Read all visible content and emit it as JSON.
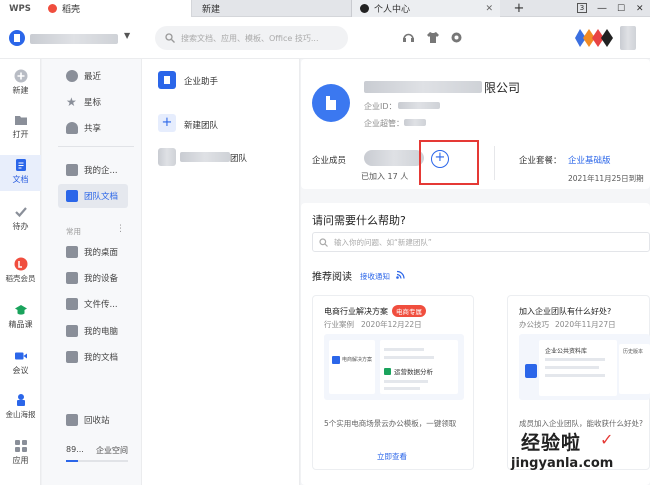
{
  "tabbar": {
    "app": "WPS",
    "tabs": [
      {
        "label": "稻壳"
      },
      {
        "label": "新建"
      },
      {
        "label": "个人中心"
      }
    ],
    "new_tab": "+",
    "win_badge": "3"
  },
  "search": {
    "placeholder": "搜索文档、应用、模板、Office 技巧..."
  },
  "sidebar": {
    "items": [
      {
        "label": "新建"
      },
      {
        "label": "打开"
      },
      {
        "label": "文档"
      },
      {
        "label": "待办"
      },
      {
        "label": "稻壳会员"
      },
      {
        "label": "精品课"
      },
      {
        "label": "会议"
      },
      {
        "label": "金山海报"
      },
      {
        "label": "应用"
      }
    ]
  },
  "nav2": {
    "recent": "最近",
    "star": "星标",
    "share": "共享",
    "my_company": "我的企...",
    "team_docs": "团队文档",
    "common": "常用",
    "desktop": "我的桌面",
    "devices": "我的设备",
    "file_transfer": "文件传...",
    "my_pc": "我的电脑",
    "my_docs": "我的文档",
    "recycle": "回收站",
    "space_num": "89...",
    "space": "企业空间"
  },
  "col3": {
    "assistant": "企业助手",
    "new_team": "新建团队",
    "team_suffix": "团队"
  },
  "company": {
    "name_suffix": "限公司",
    "id_label": "企业ID：",
    "admin_label": "企业超管：",
    "members_label": "企业成员",
    "joined": "已加入 17 人",
    "plan_label": "企业套餐：",
    "plan_value": "企业基础版",
    "expiry": "2021年11月25日到期"
  },
  "help": {
    "title": "请问需要什么帮助?",
    "placeholder": "输入你的问题、如“新建团队”"
  },
  "reading": {
    "title": "推荐阅读",
    "subscribe": "接收通知",
    "cards": [
      {
        "title": "电商行业解决方案",
        "tag": "电商专属",
        "category": "行业案例",
        "date": "2020年12月22日",
        "desc": "5个实用电商场景云办公模板，一键领取",
        "link": "立即查看",
        "preview_item": "运营数据分析",
        "preview_label": "电商解决方案"
      },
      {
        "title": "加入企业团队有什么好处?",
        "category": "办公技巧",
        "date": "2020年11月27日",
        "desc": "成员加入企业团队，能收获什么好处?",
        "preview_title": "企业公共资料库",
        "preview_side": "历史版本"
      }
    ]
  },
  "watermark": {
    "line1": "经验啦",
    "line2": "jingyanla.com"
  },
  "colors": {
    "accent": "#2b66e9",
    "highlight": "#e53935"
  }
}
